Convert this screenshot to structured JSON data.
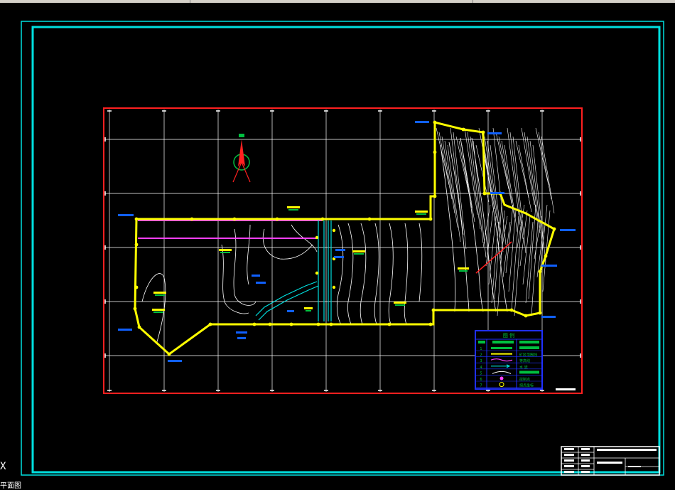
{
  "app": {
    "name": "CAD viewport",
    "background": "#000000"
  },
  "colors": {
    "frame": "#00e0e0",
    "map_border": "#ff2020",
    "grid": "#ffffff",
    "boundary": "#ffff00",
    "magenta": "#ff40ff",
    "blue_label": "#1060ff",
    "green_fill": "#00c040",
    "legend_border": "#2030ff"
  },
  "icons": {
    "north_arrow": "north-arrow-icon",
    "ucs": "ucs-axis-icon"
  },
  "viewport": {
    "ucs_label": "X",
    "command_line": "平面图"
  },
  "legend": {
    "title": "图 例",
    "col_headers": [
      "序号",
      "图例",
      "名称"
    ],
    "rows": [
      {
        "num": "1",
        "icon": "green-bar-icon",
        "name": ""
      },
      {
        "num": "2",
        "icon": "yellow-line-icon",
        "name": "矿区范围线"
      },
      {
        "num": "3",
        "icon": "magenta-wave-icon",
        "name": "等高线"
      },
      {
        "num": "4",
        "icon": "cyan-arrow-icon",
        "name": "水 流"
      },
      {
        "num": "5",
        "icon": "white-arc-icon",
        "name": ""
      },
      {
        "num": "6",
        "icon": "magenta-dot-icon",
        "name": "控制点"
      },
      {
        "num": "7",
        "icon": "yellow-circle-icon",
        "name": "拐点坐标"
      }
    ]
  },
  "title_block": {
    "rows": 5
  }
}
